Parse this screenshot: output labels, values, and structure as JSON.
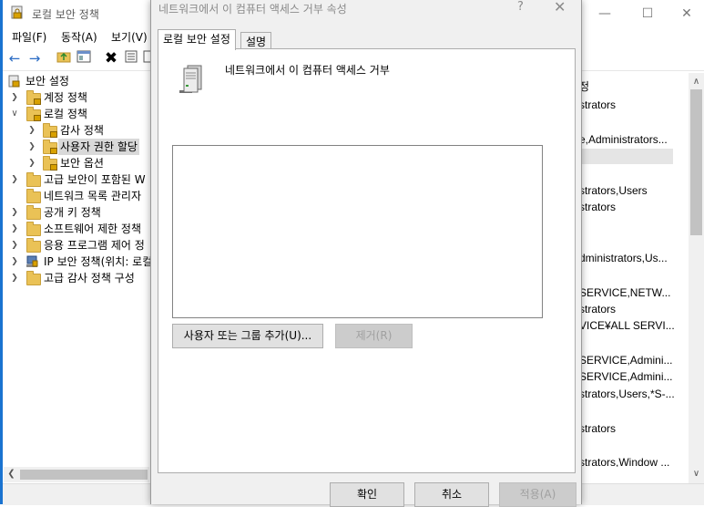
{
  "window": {
    "title": "로컬 보안 정책",
    "controls": [
      "—",
      "☐",
      "✕"
    ]
  },
  "menu": [
    "파일(F)",
    "동작(A)",
    "보기(V)"
  ],
  "tree": [
    {
      "label": "보안 설정",
      "indent": 0,
      "arrow": "",
      "icon": "security-settings-icon"
    },
    {
      "label": "계정 정책",
      "indent": 1,
      "arrow": ">",
      "icon": "folder-icon"
    },
    {
      "label": "로컬 정책",
      "indent": 1,
      "arrow": "v",
      "icon": "folder-icon"
    },
    {
      "label": "감사 정책",
      "indent": 2,
      "arrow": ">",
      "icon": "folder-icon"
    },
    {
      "label": "사용자 권한 할당",
      "indent": 2,
      "arrow": ">",
      "icon": "folder-icon",
      "selected": true
    },
    {
      "label": "보안 옵션",
      "indent": 2,
      "arrow": ">",
      "icon": "folder-icon"
    },
    {
      "label": "고급 보안이 포함된 W",
      "indent": 1,
      "arrow": ">",
      "icon": "folder-icon"
    },
    {
      "label": "네트워크 목록 관리자",
      "indent": 1,
      "arrow": "",
      "icon": "folder-icon"
    },
    {
      "label": "공개 키 정책",
      "indent": 1,
      "arrow": ">",
      "icon": "folder-icon"
    },
    {
      "label": "소프트웨어 제한 정책",
      "indent": 1,
      "arrow": ">",
      "icon": "folder-icon"
    },
    {
      "label": "응용 프로그램 제어 정",
      "indent": 1,
      "arrow": ">",
      "icon": "folder-icon"
    },
    {
      "label": "IP 보안 정책(위치: 로컬",
      "indent": 1,
      "arrow": ">",
      "icon": "ip-security-icon"
    },
    {
      "label": "고급 감사 정책 구성",
      "indent": 1,
      "arrow": ">",
      "icon": "folder-icon"
    }
  ],
  "right_panel": {
    "header": "정",
    "rows": [
      {
        "text": "strators"
      },
      {
        "text": "e,Administrators..."
      },
      {
        "text": "",
        "highlight": true
      },
      {
        "text": "strators,Users"
      },
      {
        "text": "strators"
      },
      {
        "text": ""
      },
      {
        "text": "dministrators,Us..."
      },
      {
        "text": "SERVICE,NETW..."
      },
      {
        "text": "strators"
      },
      {
        "text": "VICE¥ALL SERVI..."
      },
      {
        "text": "SERVICE,Admini..."
      },
      {
        "text": "SERVICE,Admini..."
      },
      {
        "text": "strators,Users,*S-..."
      },
      {
        "text": "strators"
      },
      {
        "text": "strators,Window ..."
      }
    ]
  },
  "dialog": {
    "title": "네트워크에서 이 컴퓨터 액세스 거부 속성",
    "help": "?",
    "close": "✕",
    "tabs": [
      "로컬 보안 설정",
      "설명"
    ],
    "policy_name": "네트워크에서 이 컴퓨터 액세스 거부",
    "add_button": "사용자 또는 그룹 추가(U)...",
    "remove_button": "제거(R)",
    "ok_button": "확인",
    "cancel_button": "취소",
    "apply_button": "적용(A)"
  },
  "colors": {
    "accent": "#1a73d0",
    "selection": "#d9d9d9",
    "dialog_bg": "#f0f0f0"
  }
}
